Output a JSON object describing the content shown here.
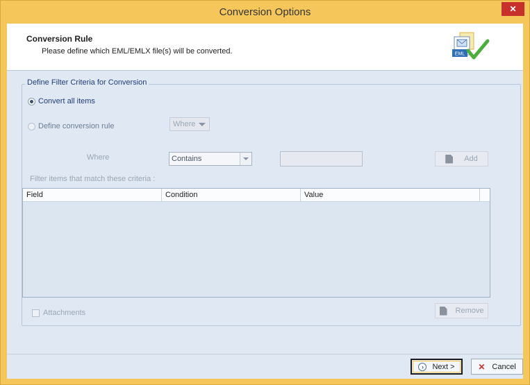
{
  "window": {
    "title": "Conversion Options",
    "close_glyph": "✕"
  },
  "header": {
    "title": "Conversion Rule",
    "subtitle": "Please define which EML/EMLX file(s) will be converted.",
    "icon_label": "EML"
  },
  "filter": {
    "group_label": "Define Filter Criteria for Conversion",
    "convert_all_label": "Convert all items",
    "define_rule_label": "Define conversion rule",
    "where_dropdown_value": "Where",
    "where_label": "Where",
    "condition_value": "Contains",
    "value_placeholder": "",
    "add_label": "Add",
    "filter_items_label": "Filter items that match these criteria :",
    "columns": [
      "Field",
      "Condition",
      "Value"
    ],
    "attachments_label": "Attachments",
    "remove_label": "Remove"
  },
  "footer": {
    "next_label": "Next >",
    "cancel_label": "Cancel"
  },
  "colors": {
    "frame": "#f5c75b",
    "close": "#c7302b",
    "panel": "#dfe8f3",
    "label_blue": "#1f3d7a"
  }
}
